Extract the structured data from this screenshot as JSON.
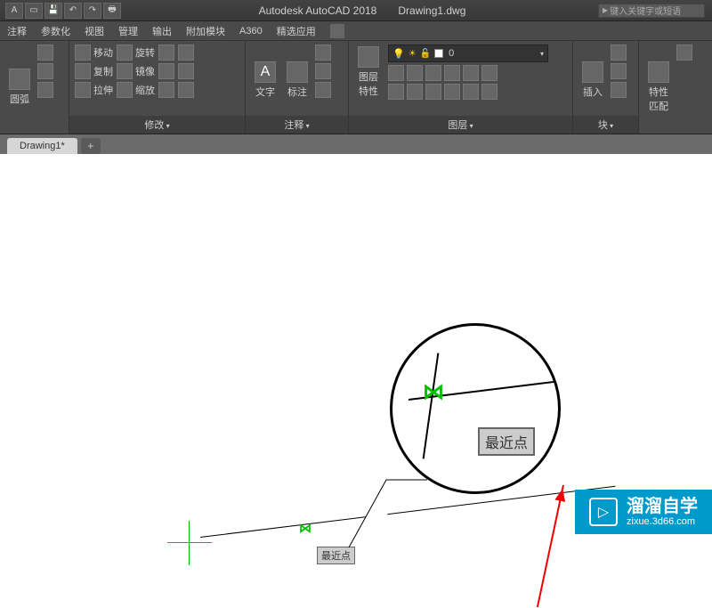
{
  "title": {
    "app": "Autodesk AutoCAD 2018",
    "doc": "Drawing1.dwg"
  },
  "search": {
    "placeholder": "键入关键字或短语"
  },
  "menus": [
    "注释",
    "参数化",
    "视图",
    "管理",
    "输出",
    "附加模块",
    "A360",
    "精选应用"
  ],
  "ribbon": {
    "draw": {
      "arc": "圆弧"
    },
    "modify": {
      "move": "移动",
      "rotate": "旋转",
      "copy": "复制",
      "mirror": "镜像",
      "stretch": "拉伸",
      "scale": "缩放",
      "label": "修改"
    },
    "annot": {
      "text": "文字",
      "dim": "标注",
      "label": "注释"
    },
    "layer": {
      "props": "图层\n特性",
      "current": "0",
      "label": "图层"
    },
    "block": {
      "insert": "插入",
      "label": "块"
    },
    "props": {
      "match": "特性\n匹配"
    }
  },
  "tab": {
    "name": "Drawing1*"
  },
  "snap": {
    "tooltip": "最近点",
    "tooltip_big": "最近点"
  },
  "watermark": {
    "main": "溜溜自学",
    "sub": "zixue.3d66.com"
  }
}
